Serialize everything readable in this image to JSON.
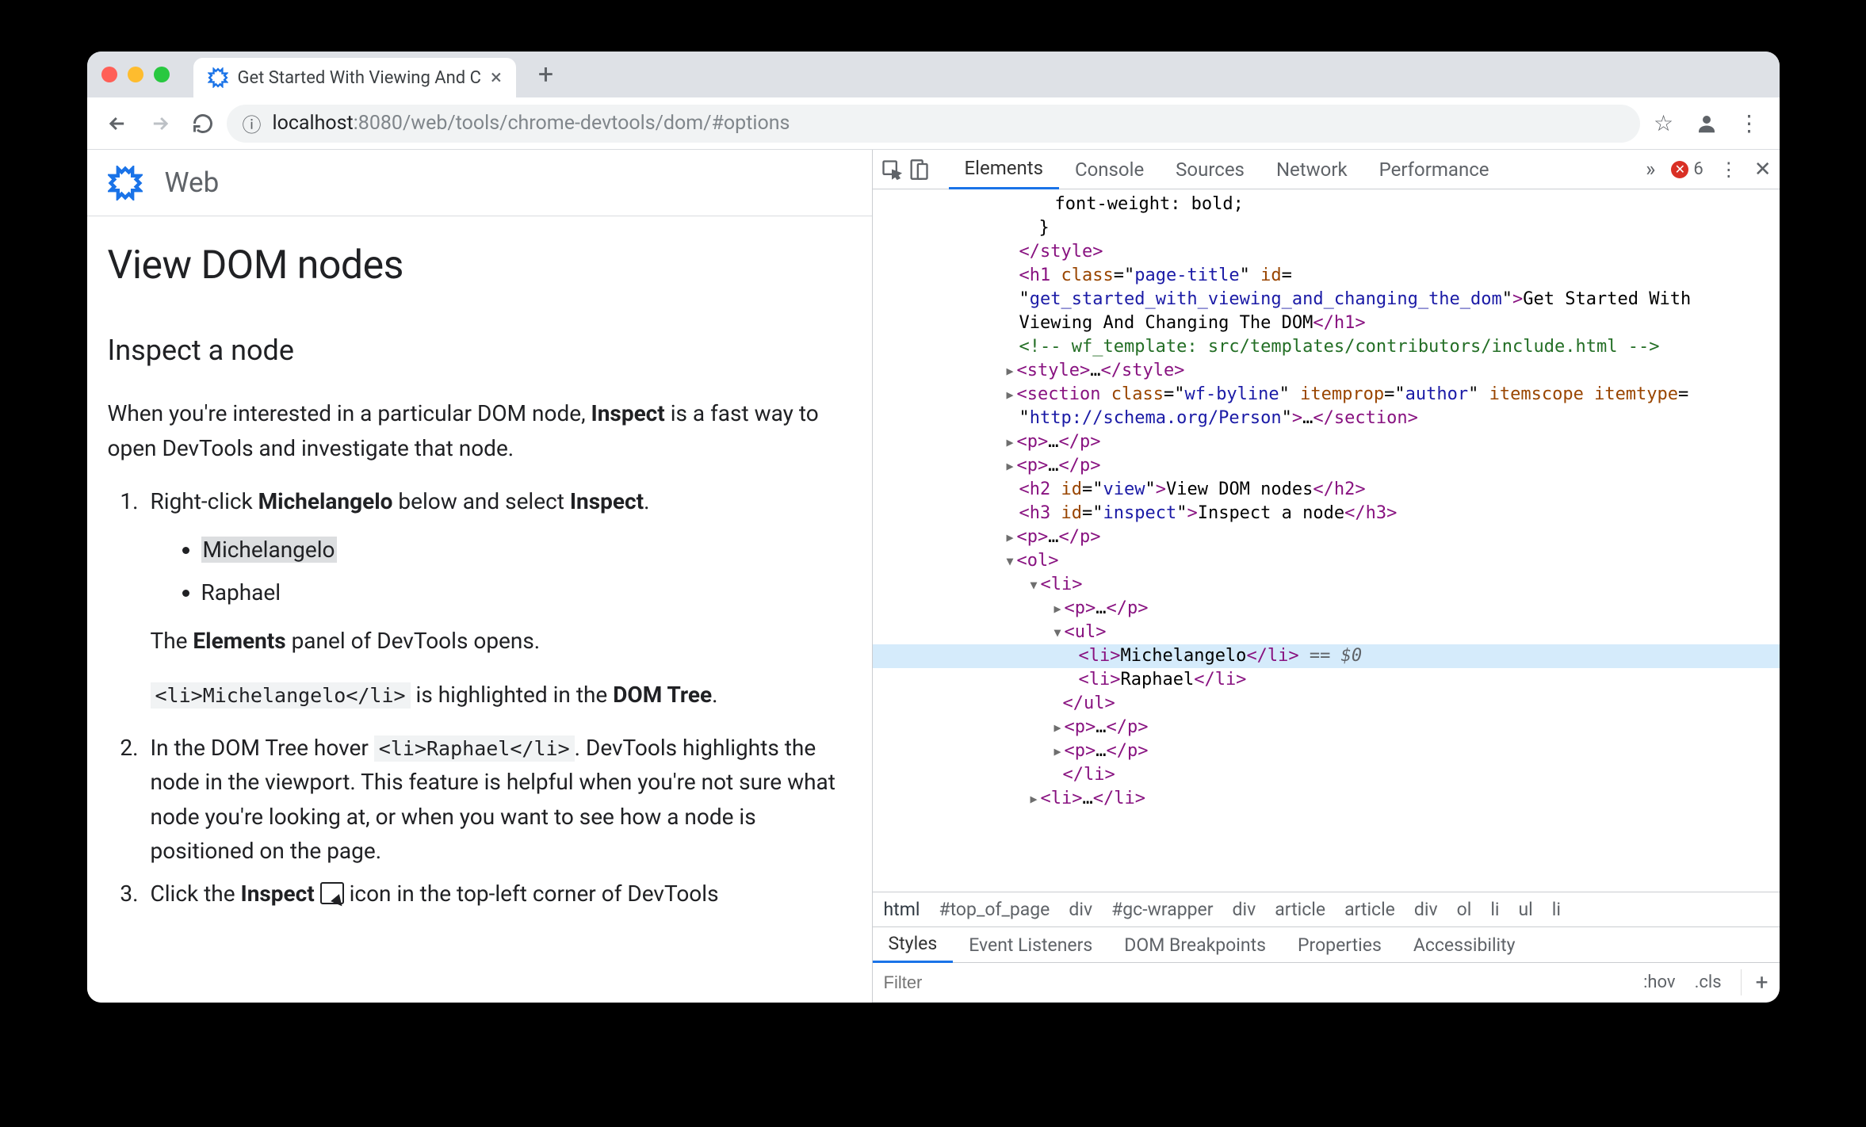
{
  "browser": {
    "tab_title": "Get Started With Viewing And C",
    "url_prefix": "localhost",
    "url_port": ":8080",
    "url_path": "/web/tools/chrome-devtools/dom/#options"
  },
  "page": {
    "site_section": "Web",
    "h2": "View DOM nodes",
    "h3": "Inspect a node",
    "intro_1": "When you're interested in a particular DOM node, ",
    "intro_bold": "Inspect",
    "intro_2": " is a fast way to open DevTools and investigate that node.",
    "step1_a": "Right-click ",
    "step1_bold1": "Michelangelo",
    "step1_b": " below and select ",
    "step1_bold2": "Inspect",
    "step1_c": ".",
    "bullets": [
      "Michelangelo",
      "Raphael"
    ],
    "step1_after_a": "The ",
    "step1_after_bold": "Elements",
    "step1_after_b": " panel of DevTools opens.",
    "step1_code": "<li>Michelangelo</li>",
    "step1_code_after_a": " is highlighted in the ",
    "step1_code_after_bold": "DOM Tree",
    "step1_code_after_b": ".",
    "step2_a": "In the DOM Tree hover ",
    "step2_code": "<li>Raphael</li>",
    "step2_b": ". DevTools highlights the node in the viewport. This feature is helpful when you're not sure what node you're looking at, or when you want to see how a node is positioned on the page.",
    "step3_a": "Click the ",
    "step3_bold": "Inspect",
    "step3_b": " icon in the top-left corner of DevTools"
  },
  "devtools": {
    "tabs": [
      "Elements",
      "Console",
      "Sources",
      "Network",
      "Performance"
    ],
    "active_tab": 0,
    "error_count": "6",
    "crumbs": [
      "html",
      "#top_of_page",
      "div",
      "#gc-wrapper",
      "div",
      "article",
      "article",
      "div",
      "ol",
      "li",
      "ul",
      "li"
    ],
    "styles_tabs": [
      "Styles",
      "Event Listeners",
      "DOM Breakpoints",
      "Properties",
      "Accessibility"
    ],
    "filter_placeholder": "Filter",
    "filter_hov": ":hov",
    "filter_cls": ".cls",
    "elements": {
      "line0": "font-weight: bold;",
      "h1_class": "page-title",
      "h1_id": "get_started_with_viewing_and_changing_the_dom",
      "h1_text": "Get Started With Viewing And Changing The DOM",
      "comment": "<!-- wf_template: src/templates/contributors/include.html -->",
      "section_class": "wf-byline",
      "section_itemprop": "author",
      "section_itemtype": "http://schema.org/Person",
      "h2_id": "view",
      "h2_text": "View DOM nodes",
      "h3_id": "inspect",
      "h3_text": "Inspect a node",
      "li1": "Michelangelo",
      "li2": "Raphael",
      "selected_suffix": " == $0"
    }
  }
}
